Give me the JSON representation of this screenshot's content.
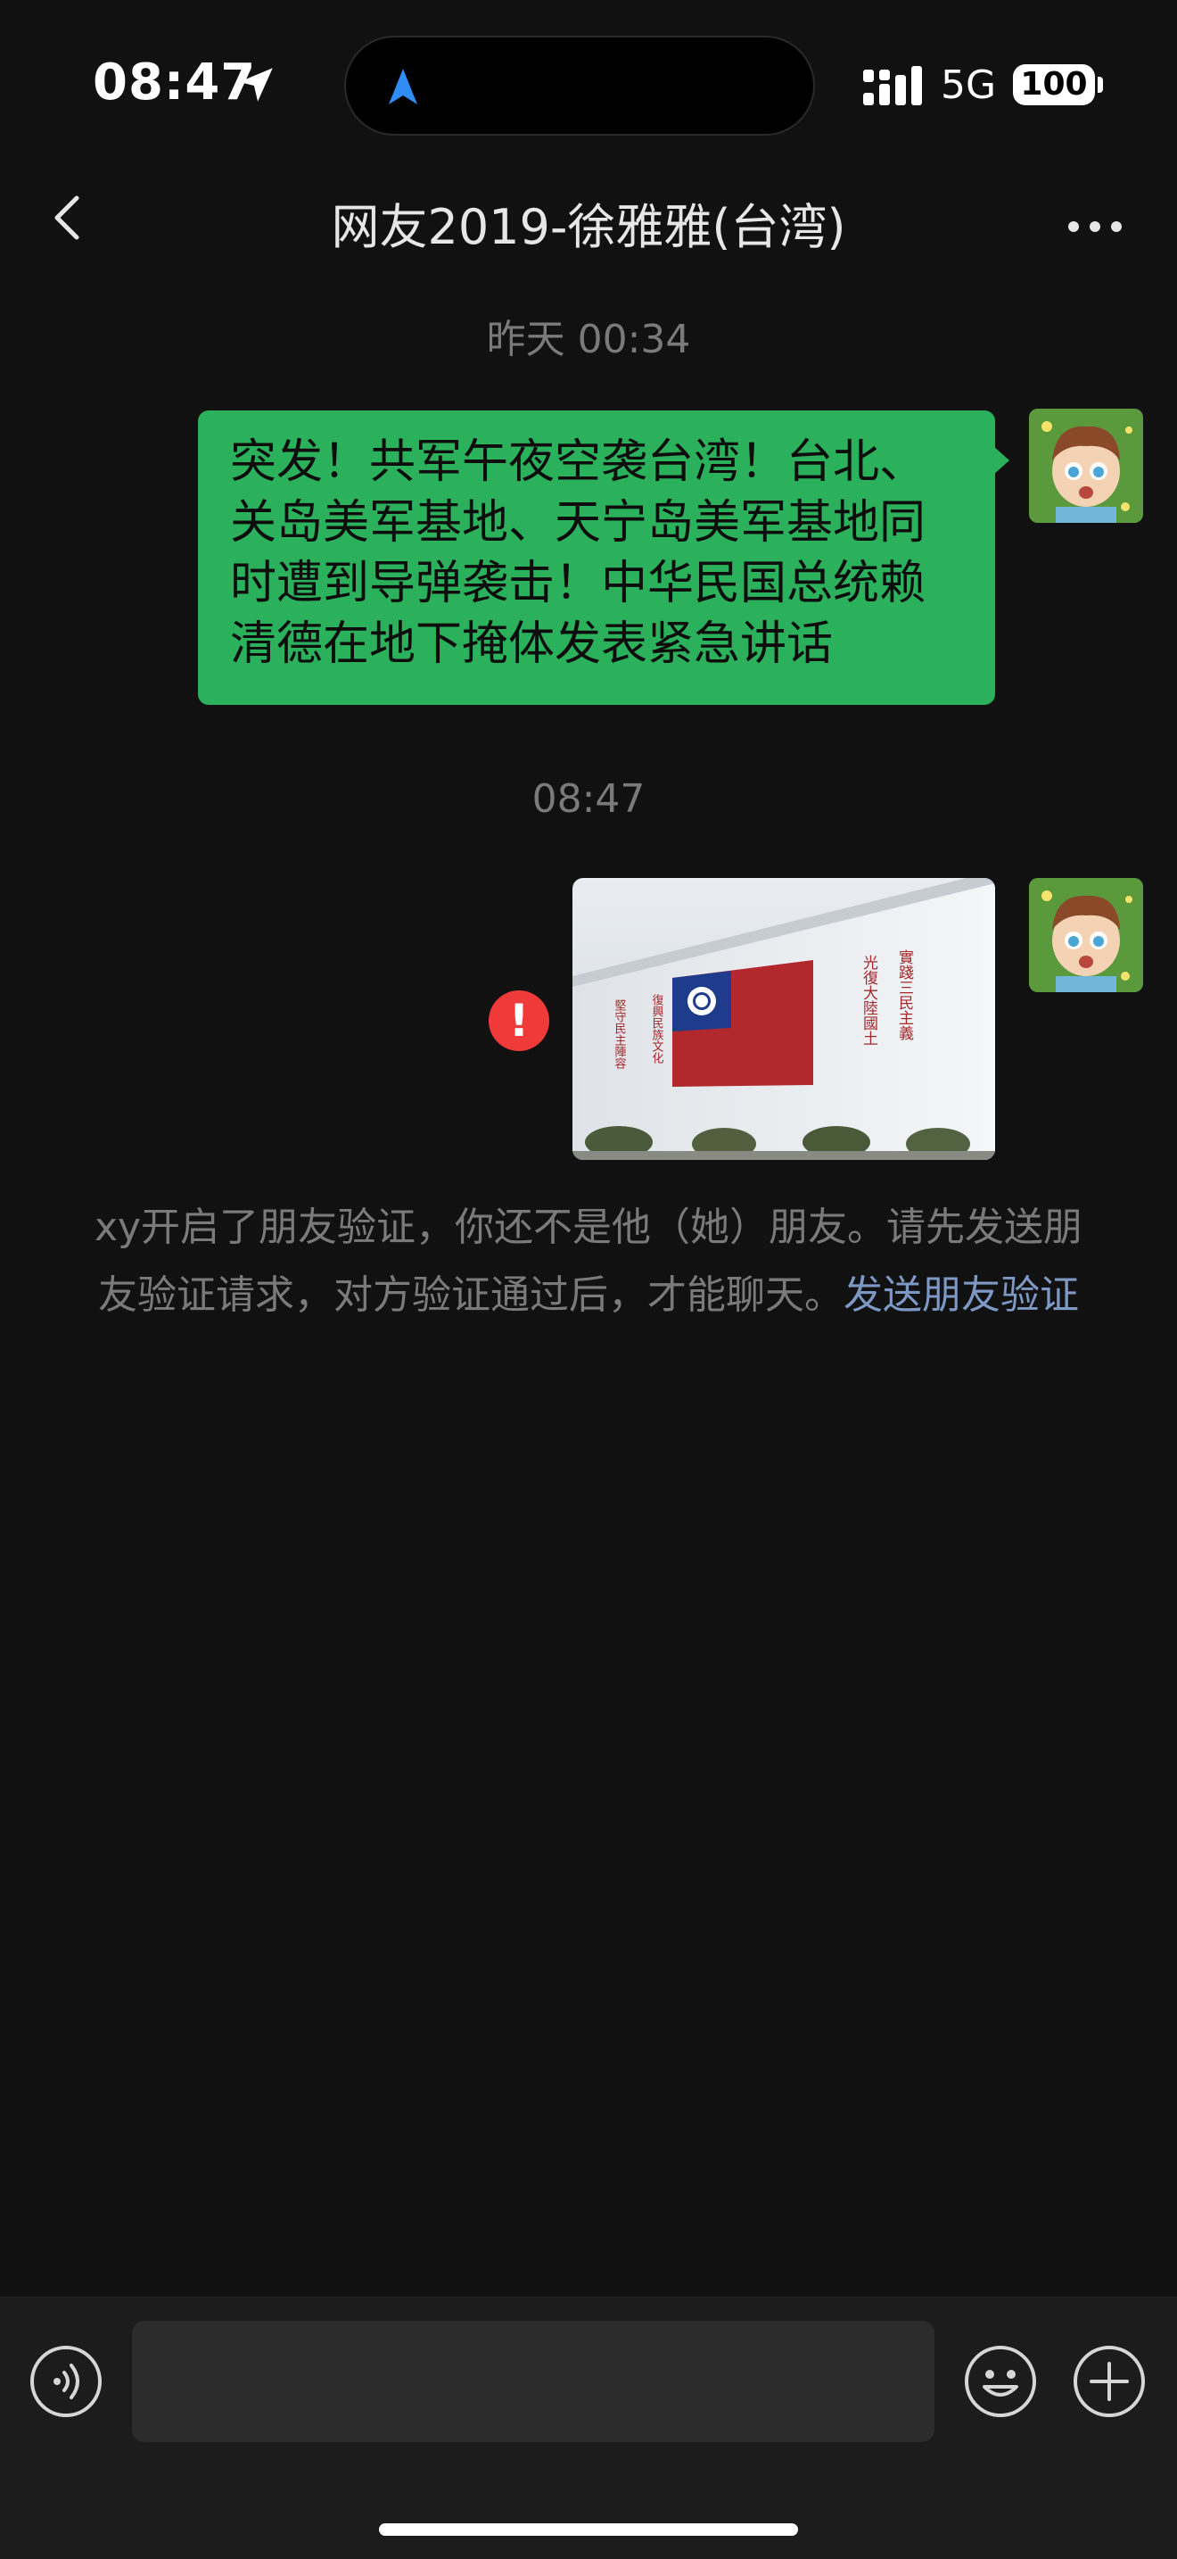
{
  "status_bar": {
    "time": "08:47",
    "network": "5G",
    "battery": "100"
  },
  "header": {
    "title": "网友2019-徐雅雅(台湾)",
    "back_icon": "chevron-left-icon",
    "more_icon": "more-dots-icon"
  },
  "messages": {
    "timestamp_1": "昨天 00:34",
    "text_message": "突发！共军午夜空袭台湾！台北、关岛美军基地、天宁岛美军基地同时遭到导弹袭击！中华民国总统赖清德在地下掩体发表紧急讲话",
    "timestamp_2": "08:47",
    "image_wall_text": {
      "right_col_1": "實踐三民主義",
      "right_col_2": "光復大陸國土",
      "left_col_1": "復興民族文化",
      "left_col_2": "堅守民主陣容"
    },
    "error_mark": "!"
  },
  "system_notice": {
    "text": "xy开启了朋友验证，你还不是他（她）朋友。请先发送朋友验证请求，对方验证通过后，才能聊天。",
    "link": "发送朋友验证"
  },
  "input_bar": {
    "placeholder": "",
    "voice_icon": "voice-icon",
    "emoji_icon": "emoji-icon",
    "plus_icon": "plus-icon"
  },
  "colors": {
    "background": "#111111",
    "bubble": "#2bb15c",
    "error": "#f03a3a",
    "link": "#7d98c4"
  }
}
